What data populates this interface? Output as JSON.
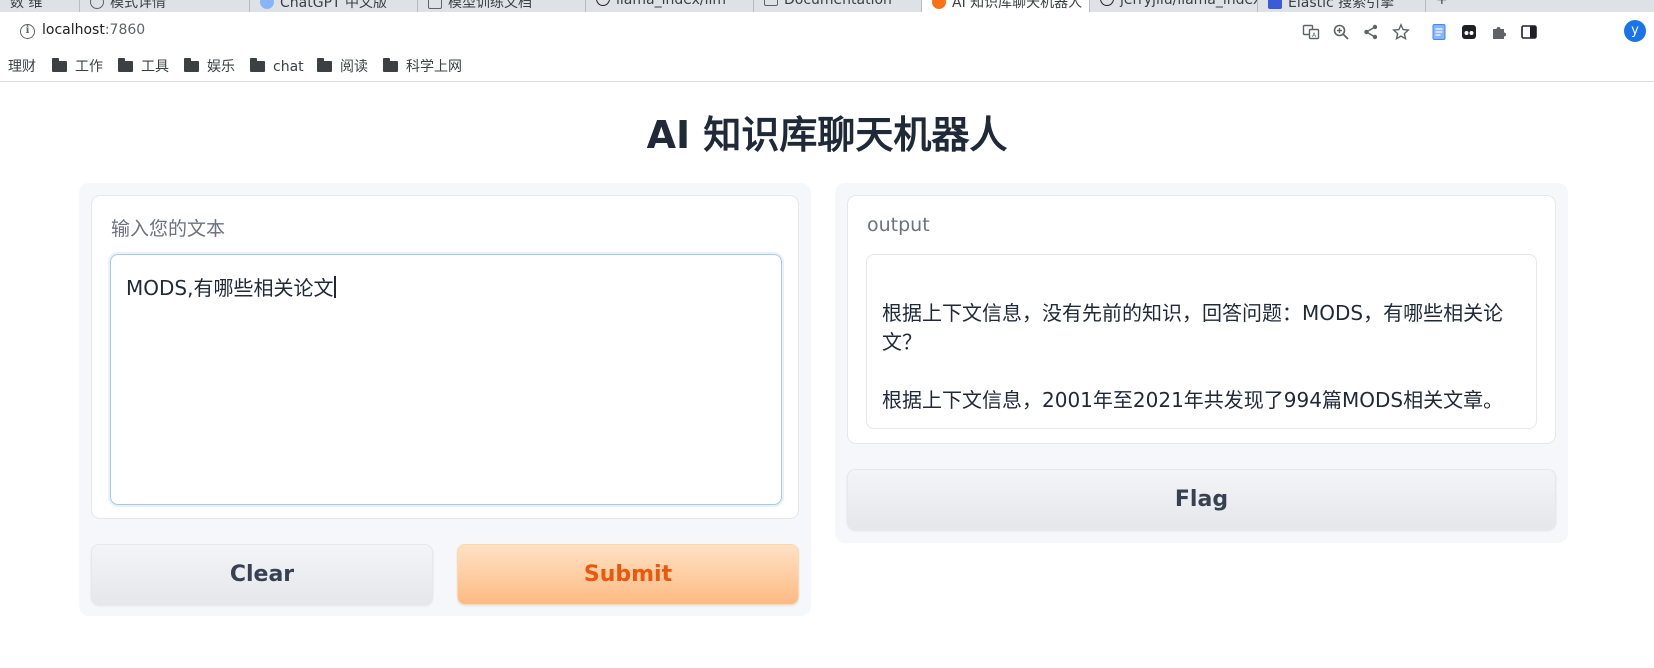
{
  "browser": {
    "tabs": [
      {
        "label": "数 维",
        "active": false
      },
      {
        "label": "模式详情",
        "active": false
      },
      {
        "label": "ChatGPT 中文版",
        "active": false
      },
      {
        "label": "模型训练文档",
        "active": false
      },
      {
        "label": "llama_index/llm",
        "active": false
      },
      {
        "label": "Documentation",
        "active": false
      },
      {
        "label": "AI 知识库聊天机器人",
        "active": true
      },
      {
        "label": "jerryjliu/llama_index",
        "active": false
      },
      {
        "label": "Elastic 搜索引擎",
        "active": false
      }
    ],
    "url_host": "localhost",
    "url_port": ":7860",
    "profile_initial": "y",
    "bookmarks": [
      {
        "label": "理财",
        "folder": false
      },
      {
        "label": "工作",
        "folder": true
      },
      {
        "label": "工具",
        "folder": true
      },
      {
        "label": "娱乐",
        "folder": true
      },
      {
        "label": "chat",
        "folder": true
      },
      {
        "label": "阅读",
        "folder": true
      },
      {
        "label": "科学上网",
        "folder": true
      }
    ]
  },
  "app": {
    "title": "AI 知识库聊天机器人",
    "input": {
      "label": "输入您的文本",
      "value": "MODS,有哪些相关论文"
    },
    "output": {
      "label": "output",
      "paragraphs": [
        "根据上下文信息，没有先前的知识，回答问题：MODS，有哪些相关论文？",
        "根据上下文信息，2001年至2021年共发现了994篇MODS相关文章。"
      ]
    },
    "buttons": {
      "clear": "Clear",
      "submit": "Submit",
      "flag": "Flag"
    }
  },
  "colors": {
    "primary_text": "#ea580c",
    "primary_bg": "#fdba83",
    "focus_border": "#a5c8f0"
  }
}
